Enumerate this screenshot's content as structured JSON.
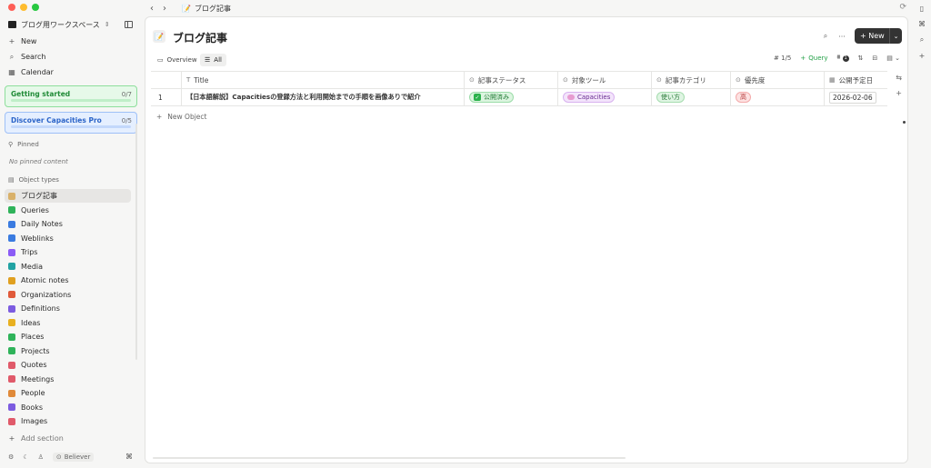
{
  "window": {
    "breadcrumb": "ブログ記事"
  },
  "sidebar": {
    "workspace": "ブログ用ワークスペース",
    "nav": [
      {
        "label": "New",
        "icon": "plus-icon"
      },
      {
        "label": "Search",
        "icon": "search-icon"
      },
      {
        "label": "Calendar",
        "icon": "calendar-icon"
      }
    ],
    "getting_started": {
      "label": "Getting started",
      "count": "0/7"
    },
    "discover": {
      "label": "Discover Capacities Pro",
      "count": "0/5"
    },
    "pinned_label": "Pinned",
    "no_pinned": "No pinned content",
    "object_types_label": "Object types",
    "object_types": [
      {
        "label": "ブログ記事",
        "color": "#d9b16a"
      },
      {
        "label": "Queries",
        "color": "#2fb35a"
      },
      {
        "label": "Daily Notes",
        "color": "#3a7be0"
      },
      {
        "label": "Weblinks",
        "color": "#3a7be0"
      },
      {
        "label": "Trips",
        "color": "#8b5cf6"
      },
      {
        "label": "Media",
        "color": "#22a3a3"
      },
      {
        "label": "Atomic notes",
        "color": "#e0a020"
      },
      {
        "label": "Organizations",
        "color": "#e05a3a"
      },
      {
        "label": "Definitions",
        "color": "#7c5ce0"
      },
      {
        "label": "Ideas",
        "color": "#e8b020"
      },
      {
        "label": "Places",
        "color": "#2fb35a"
      },
      {
        "label": "Projects",
        "color": "#2fb35a"
      },
      {
        "label": "Quotes",
        "color": "#e05a6a"
      },
      {
        "label": "Meetings",
        "color": "#e05a6a"
      },
      {
        "label": "People",
        "color": "#e08a3a"
      },
      {
        "label": "Books",
        "color": "#7c5ce0"
      },
      {
        "label": "Images",
        "color": "#e05a6a"
      }
    ],
    "add_section": "Add section",
    "plan_badge": "Believer"
  },
  "main": {
    "title": "ブログ記事",
    "new_button": "New",
    "tabs": [
      {
        "label": "Overview"
      },
      {
        "label": "All"
      }
    ],
    "toolbar": {
      "count": "1/5",
      "query": "Query",
      "filter_count": "1"
    },
    "columns": [
      {
        "label": "",
        "icon": ""
      },
      {
        "label": "Title",
        "icon": "T"
      },
      {
        "label": "記事ステータス",
        "icon": "⊙"
      },
      {
        "label": "対象ツール",
        "icon": "⊙"
      },
      {
        "label": "記事カテゴリ",
        "icon": "⊙"
      },
      {
        "label": "優先度",
        "icon": "⊙"
      },
      {
        "label": "公開予定日",
        "icon": "▦"
      }
    ],
    "rows": [
      {
        "index": "1",
        "title": "【日本語解説】Capacitiesの登録方法と利用開始までの手順を画像ありで紹介",
        "status": "公開済み",
        "tool": "Capacities",
        "category": "使い方",
        "priority": "高",
        "date": "2026-02-06"
      }
    ],
    "new_object": "New Object"
  }
}
